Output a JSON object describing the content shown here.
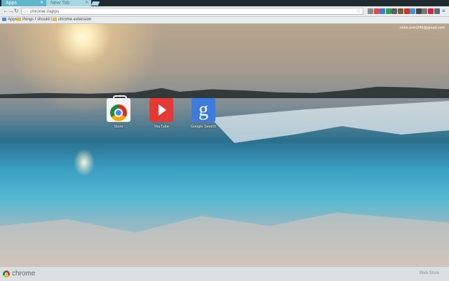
{
  "tabs": [
    {
      "title": "Apps",
      "active": true
    },
    {
      "title": "New Tab",
      "active": false
    }
  ],
  "toolbar": {
    "url": "chrome://apps"
  },
  "extensions": [
    {
      "name": "extension-icon-1",
      "color": "#8a8a8a"
    },
    {
      "name": "extension-icon-2",
      "color": "#e5474b"
    },
    {
      "name": "extension-icon-3",
      "color": "#3b7bd4"
    },
    {
      "name": "extension-icon-4",
      "color": "#2e9d4f"
    },
    {
      "name": "extension-icon-5",
      "color": "#5e5e5e"
    },
    {
      "name": "extension-icon-6",
      "color": "#7a5a3a"
    },
    {
      "name": "extension-icon-7",
      "color": "#c0392b"
    },
    {
      "name": "extension-icon-8",
      "color": "#4a90d9"
    },
    {
      "name": "extension-icon-9",
      "color": "#444444"
    },
    {
      "name": "extension-icon-10",
      "color": "#777777"
    },
    {
      "name": "extension-icon-11",
      "color": "#d1233a"
    },
    {
      "name": "extension-icon-12",
      "color": "#5a6a7a"
    }
  ],
  "bookmarks": [
    {
      "label": "Apps",
      "icon": "apps-grid-icon",
      "color": "#4b8bd6"
    },
    {
      "label": "things I should l...",
      "icon": "folder-icon",
      "color": "#e0b94a"
    },
    {
      "label": "chrome extension",
      "icon": "folder-icon",
      "color": "#e0b94a"
    }
  ],
  "user": {
    "email": "nebs.eren249@gmail.com"
  },
  "apps": [
    {
      "label": "Store",
      "icon": "chrome-web-store-icon"
    },
    {
      "label": "YouTube",
      "icon": "youtube-icon"
    },
    {
      "label": "Google Search",
      "icon": "google-search-icon"
    }
  ],
  "footer": {
    "brand": "chrome",
    "webstore": "Web Store"
  }
}
